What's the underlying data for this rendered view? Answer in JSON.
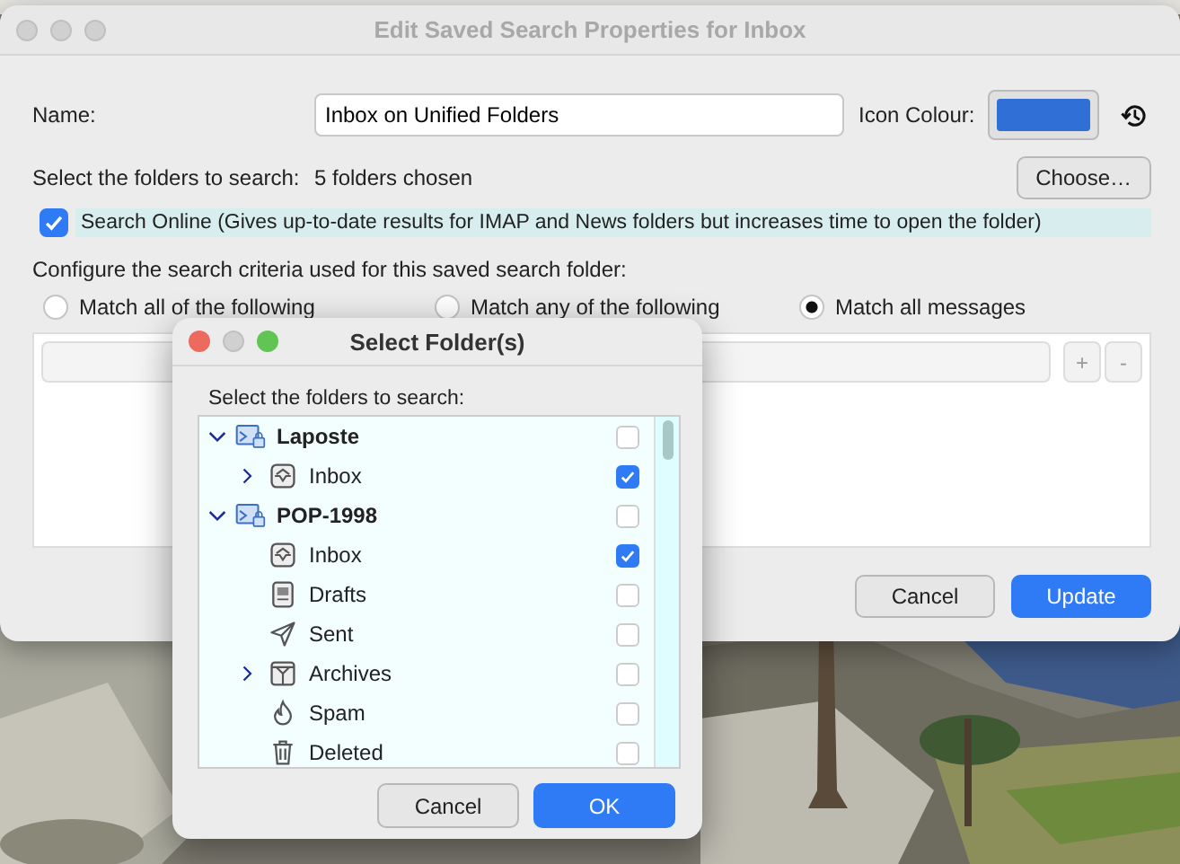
{
  "window": {
    "title": "Edit Saved Search Properties for Inbox"
  },
  "name_field": {
    "label": "Name:",
    "value": "Inbox on Unified Folders"
  },
  "icon_colour": {
    "label": "Icon Colour:",
    "color": "#2f6fd6"
  },
  "folders": {
    "label": "Select the folders to search:",
    "value": "5 folders chosen",
    "button": "Choose…"
  },
  "search_online": {
    "label": "Search Online (Gives up-to-date results for IMAP and News folders but increases time to open the folder)",
    "checked": true
  },
  "criteria": {
    "label": "Configure the search criteria used for this saved search folder:",
    "options": [
      {
        "label": "Match all of the following",
        "selected": false
      },
      {
        "label": "Match any of the following",
        "selected": false
      },
      {
        "label": "Match all messages",
        "selected": true
      }
    ],
    "add": "+",
    "remove": "-"
  },
  "buttons": {
    "cancel": "Cancel",
    "ok": "Update"
  },
  "dialog": {
    "title": "Select Folder(s)",
    "label": "Select the folders to search:",
    "tree": [
      {
        "name": "Laposte",
        "kind": "account",
        "checked": false,
        "expanded": true,
        "children": [
          {
            "name": "Inbox",
            "kind": "inbox",
            "checked": true,
            "expanded": false
          }
        ]
      },
      {
        "name": "POP-1998",
        "kind": "account",
        "checked": false,
        "expanded": true,
        "children": [
          {
            "name": "Inbox",
            "kind": "inbox",
            "checked": true
          },
          {
            "name": "Drafts",
            "kind": "drafts",
            "checked": false
          },
          {
            "name": "Sent",
            "kind": "sent",
            "checked": false
          },
          {
            "name": "Archives",
            "kind": "archives",
            "checked": false,
            "expanded": false
          },
          {
            "name": "Spam",
            "kind": "spam",
            "checked": false
          },
          {
            "name": "Deleted",
            "kind": "trash",
            "checked": false
          }
        ]
      }
    ],
    "cancel": "Cancel",
    "ok": "OK"
  }
}
